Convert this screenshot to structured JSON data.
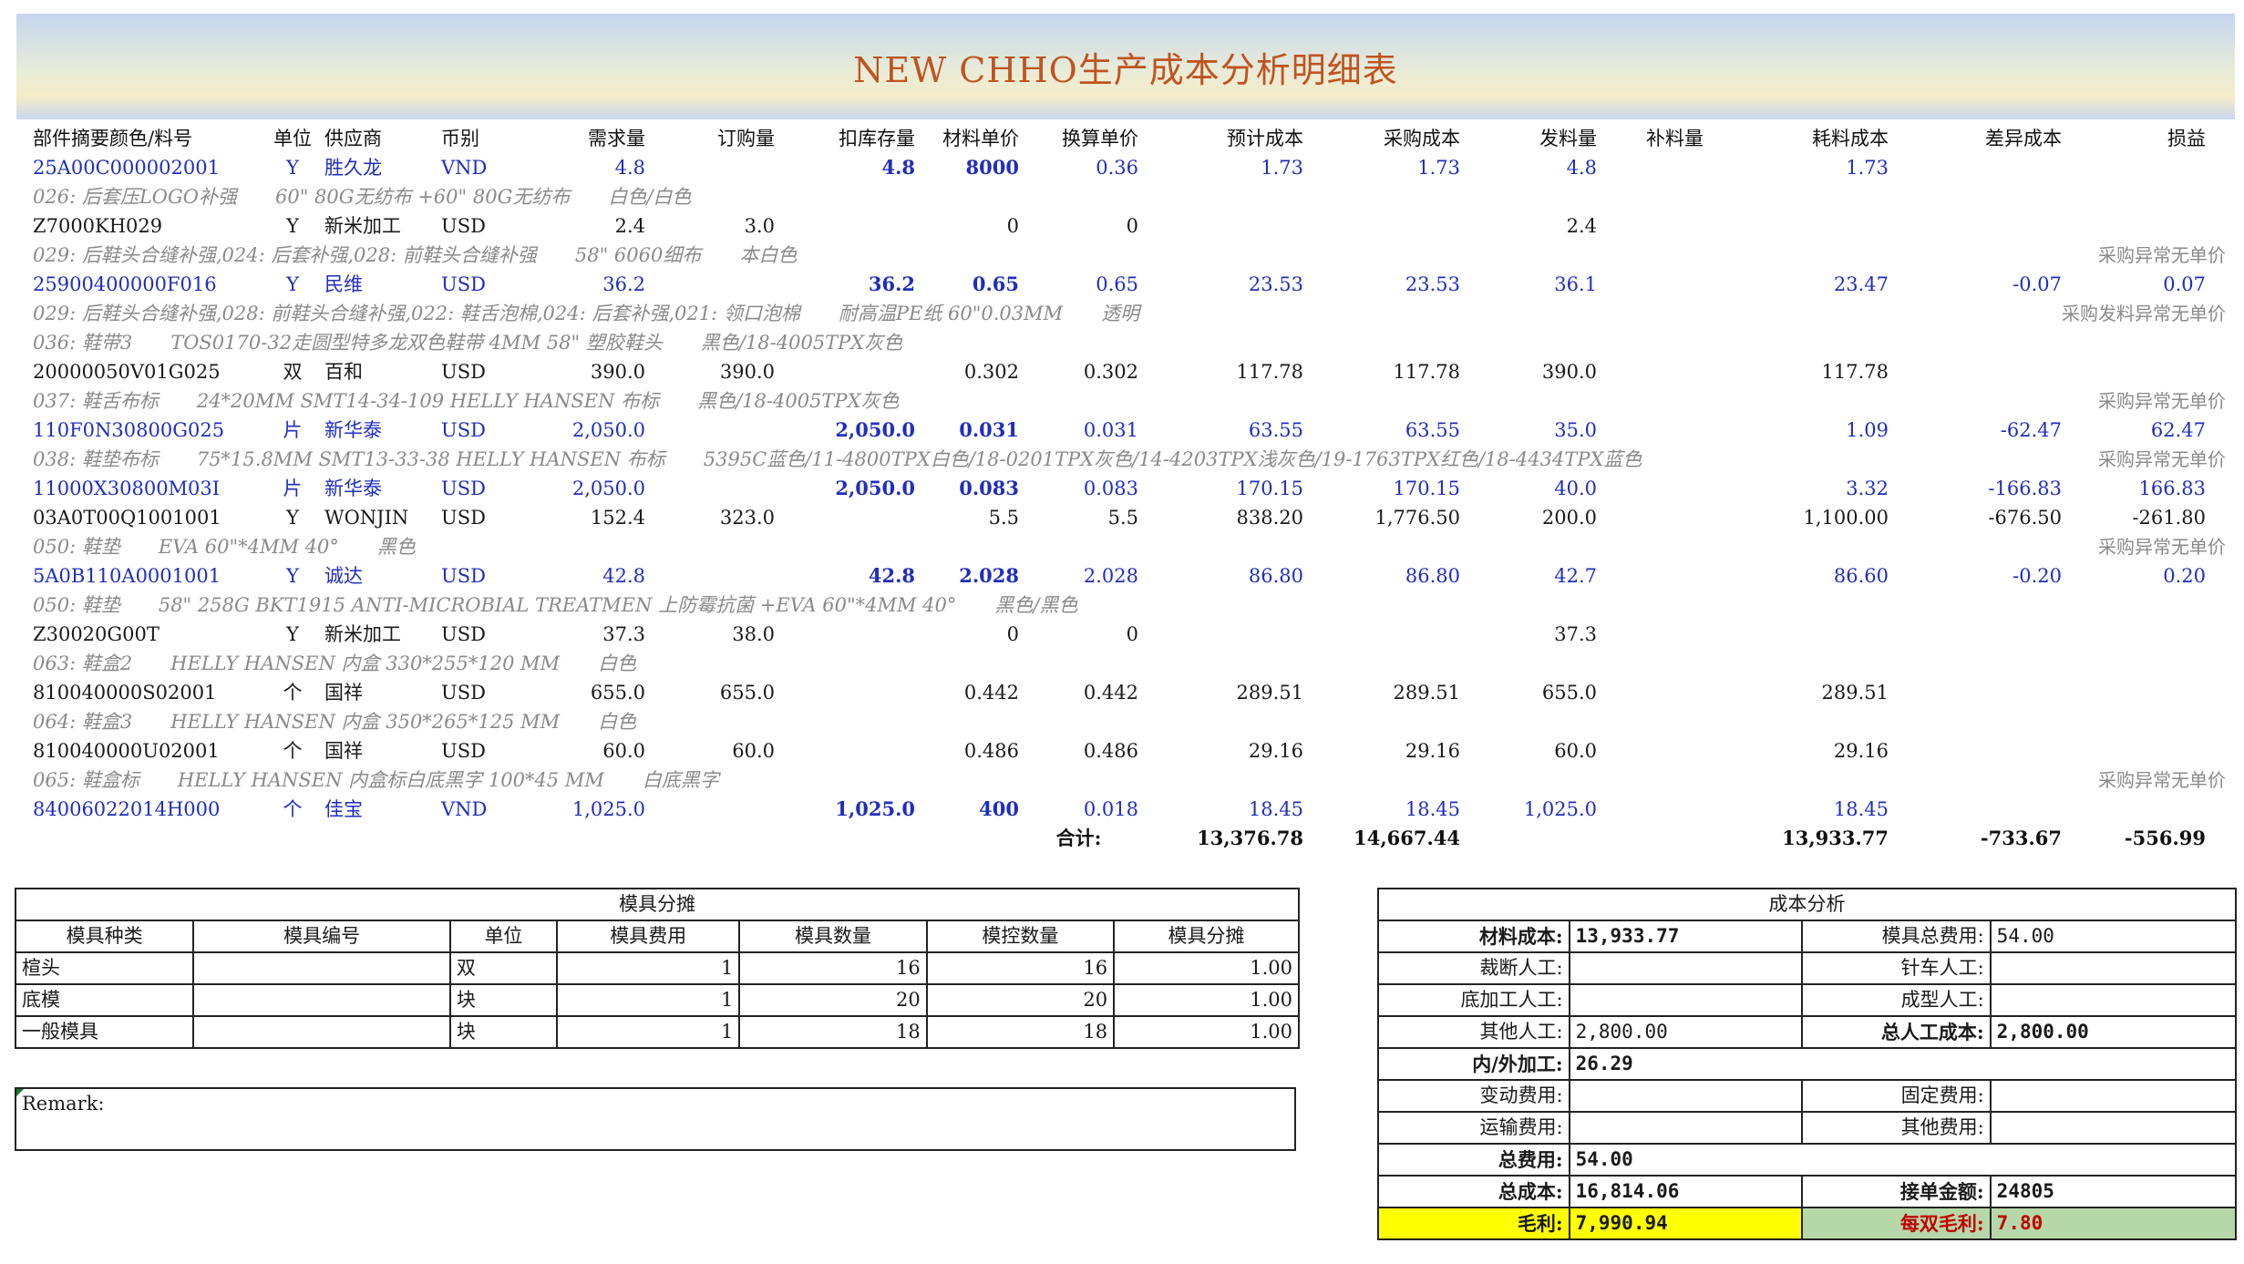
{
  "title": "NEW CHHO生产成本分析明细表",
  "headers": {
    "part": "部件摘要颜色/料号",
    "unit": "单位",
    "supplier": "供应商",
    "currency": "币别",
    "demand": "需求量",
    "order": "订购量",
    "stock": "扣库存量",
    "mat_price": "材料单价",
    "conv_price": "换算单价",
    "est_cost": "预计成本",
    "pur_cost": "采购成本",
    "issue": "发料量",
    "supp": "补料量",
    "consume_cost": "耗料成本",
    "diff_cost": "差异成本",
    "profit_loss": "损益"
  },
  "rows": [
    {
      "type": "data",
      "color": "blue",
      "part": "25A00C000002001",
      "unit": "Y",
      "supplier": "胜久龙",
      "currency": "VND",
      "demand": "4.8",
      "order": "",
      "stock": "4.8",
      "mat_price": "8000",
      "conv_price": "0.36",
      "est_cost": "1.73",
      "pur_cost": "1.73",
      "issue": "4.8",
      "supp": "",
      "consume_cost": "1.73",
      "diff_cost": "",
      "profit_loss": ""
    },
    {
      "type": "desc",
      "text": "026: 后套压LOGO补强　　60\" 80G无纺布 +60\" 80G无纺布　　白色/白色",
      "note": ""
    },
    {
      "type": "data",
      "color": "black",
      "part": "Z7000KH029",
      "unit": "Y",
      "supplier": "新米加工",
      "currency": "USD",
      "demand": "2.4",
      "order": "3.0",
      "stock": "",
      "mat_price": "0",
      "conv_price": "0",
      "est_cost": "",
      "pur_cost": "",
      "issue": "2.4",
      "supp": "",
      "consume_cost": "",
      "diff_cost": "",
      "profit_loss": ""
    },
    {
      "type": "desc",
      "text": "029: 后鞋头合缝补强,024: 后套补强,028: 前鞋头合缝补强　　58\" 6060细布　　本白色",
      "note": "采购异常无单价"
    },
    {
      "type": "data",
      "color": "blue",
      "part": "25900400000F016",
      "unit": "Y",
      "supplier": "民维",
      "currency": "USD",
      "demand": "36.2",
      "order": "",
      "stock": "36.2",
      "mat_price": "0.65",
      "conv_price": "0.65",
      "est_cost": "23.53",
      "pur_cost": "23.53",
      "issue": "36.1",
      "supp": "",
      "consume_cost": "23.47",
      "diff_cost": "-0.07",
      "profit_loss": "0.07"
    },
    {
      "type": "desc",
      "text": "029: 后鞋头合缝补强,028: 前鞋头合缝补强,022: 鞋舌泡棉,024: 后套补强,021: 领口泡棉　　耐高温PE纸 60\"0.03MM　　透明",
      "note": "采购发料异常无单价"
    },
    {
      "type": "desc",
      "text": "036: 鞋带3　　TOS0170-32走圆型特多龙双色鞋带 4MM 58\" 塑胶鞋头　　黑色/18-4005TPX灰色",
      "note": ""
    },
    {
      "type": "data",
      "color": "black",
      "part": "20000050V01G025",
      "unit": "双",
      "supplier": "百和",
      "currency": "USD",
      "demand": "390.0",
      "order": "390.0",
      "stock": "",
      "mat_price": "0.302",
      "conv_price": "0.302",
      "est_cost": "117.78",
      "pur_cost": "117.78",
      "issue": "390.0",
      "supp": "",
      "consume_cost": "117.78",
      "diff_cost": "",
      "profit_loss": ""
    },
    {
      "type": "desc",
      "text": "037: 鞋舌布标　　24*20MM SMT14-34-109 HELLY HANSEN 布标　　黑色/18-4005TPX灰色",
      "note": "采购异常无单价"
    },
    {
      "type": "data",
      "color": "blue",
      "part": "110F0N30800G025",
      "unit": "片",
      "supplier": "新华泰",
      "currency": "USD",
      "demand": "2,050.0",
      "order": "",
      "stock": "2,050.0",
      "mat_price": "0.031",
      "conv_price": "0.031",
      "est_cost": "63.55",
      "pur_cost": "63.55",
      "issue": "35.0",
      "supp": "",
      "consume_cost": "1.09",
      "diff_cost": "-62.47",
      "profit_loss": "62.47"
    },
    {
      "type": "desc",
      "text": "038: 鞋垫布标　　75*15.8MM SMT13-33-38 HELLY HANSEN 布标　　5395C蓝色/11-4800TPX白色/18-0201TPX灰色/14-4203TPX浅灰色/19-1763TPX红色/18-4434TPX蓝色",
      "note": "采购异常无单价"
    },
    {
      "type": "data",
      "color": "blue",
      "part": "11000X30800M03I",
      "unit": "片",
      "supplier": "新华泰",
      "currency": "USD",
      "demand": "2,050.0",
      "order": "",
      "stock": "2,050.0",
      "mat_price": "0.083",
      "conv_price": "0.083",
      "est_cost": "170.15",
      "pur_cost": "170.15",
      "issue": "40.0",
      "supp": "",
      "consume_cost": "3.32",
      "diff_cost": "-166.83",
      "profit_loss": "166.83"
    },
    {
      "type": "data",
      "color": "black",
      "part": "03A0T00Q1001001",
      "unit": "Y",
      "supplier": "WONJIN",
      "currency": "USD",
      "demand": "152.4",
      "order": "323.0",
      "stock": "",
      "mat_price": "5.5",
      "conv_price": "5.5",
      "est_cost": "838.20",
      "pur_cost": "1,776.50",
      "issue": "200.0",
      "supp": "",
      "consume_cost": "1,100.00",
      "diff_cost": "-676.50",
      "profit_loss": "-261.80"
    },
    {
      "type": "desc",
      "text": "050: 鞋垫　　EVA 60\"*4MM 40°　　黑色",
      "note": "采购异常无单价"
    },
    {
      "type": "data",
      "color": "blue",
      "part": "5A0B110A0001001",
      "unit": "Y",
      "supplier": "诚达",
      "currency": "USD",
      "demand": "42.8",
      "order": "",
      "stock": "42.8",
      "mat_price": "2.028",
      "conv_price": "2.028",
      "est_cost": "86.80",
      "pur_cost": "86.80",
      "issue": "42.7",
      "supp": "",
      "consume_cost": "86.60",
      "diff_cost": "-0.20",
      "profit_loss": "0.20"
    },
    {
      "type": "desc",
      "text": "050: 鞋垫　　58\" 258G BKT1915 ANTI-MICROBIAL TREATMEN 上防霉抗菌 +EVA 60\"*4MM 40°　　黑色/黑色",
      "note": ""
    },
    {
      "type": "data",
      "color": "black",
      "part": "Z30020G00T",
      "unit": "Y",
      "supplier": "新米加工",
      "currency": "USD",
      "demand": "37.3",
      "order": "38.0",
      "stock": "",
      "mat_price": "0",
      "conv_price": "0",
      "est_cost": "",
      "pur_cost": "",
      "issue": "37.3",
      "supp": "",
      "consume_cost": "",
      "diff_cost": "",
      "profit_loss": ""
    },
    {
      "type": "desc",
      "text": "063: 鞋盒2　　HELLY HANSEN 内盒 330*255*120 MM　　白色",
      "note": ""
    },
    {
      "type": "data",
      "color": "black",
      "part": "810040000S02001",
      "unit": "个",
      "supplier": "国祥",
      "currency": "USD",
      "demand": "655.0",
      "order": "655.0",
      "stock": "",
      "mat_price": "0.442",
      "conv_price": "0.442",
      "est_cost": "289.51",
      "pur_cost": "289.51",
      "issue": "655.0",
      "supp": "",
      "consume_cost": "289.51",
      "diff_cost": "",
      "profit_loss": ""
    },
    {
      "type": "desc",
      "text": "064: 鞋盒3　　HELLY HANSEN 内盒 350*265*125 MM　　白色",
      "note": ""
    },
    {
      "type": "data",
      "color": "black",
      "part": "810040000U02001",
      "unit": "个",
      "supplier": "国祥",
      "currency": "USD",
      "demand": "60.0",
      "order": "60.0",
      "stock": "",
      "mat_price": "0.486",
      "conv_price": "0.486",
      "est_cost": "29.16",
      "pur_cost": "29.16",
      "issue": "60.0",
      "supp": "",
      "consume_cost": "29.16",
      "diff_cost": "",
      "profit_loss": ""
    },
    {
      "type": "desc",
      "text": "065: 鞋盒标　　HELLY HANSEN 内盒标白底黑字 100*45 MM　　白底黑字",
      "note": "采购异常无单价"
    },
    {
      "type": "data",
      "color": "blue",
      "part": "84006022014H000",
      "unit": "个",
      "supplier": "佳宝",
      "currency": "VND",
      "demand": "1,025.0",
      "order": "",
      "stock": "1,025.0",
      "mat_price": "400",
      "conv_price": "0.018",
      "est_cost": "18.45",
      "pur_cost": "18.45",
      "issue": "1,025.0",
      "supp": "",
      "consume_cost": "18.45",
      "diff_cost": "",
      "profit_loss": ""
    }
  ],
  "totals": {
    "label": "合计:",
    "est_cost": "13,376.78",
    "pur_cost": "14,667.44",
    "consume_cost": "13,933.77",
    "diff_cost": "-733.67",
    "profit_loss": "-556.99"
  },
  "mold": {
    "caption": "模具分摊",
    "headers": [
      "模具种类",
      "模具编号",
      "单位",
      "模具费用",
      "模具数量",
      "模控数量",
      "模具分摊"
    ],
    "rows": [
      [
        "楦头",
        "",
        "双",
        "1",
        "16",
        "16",
        "1.00"
      ],
      [
        "底模",
        "",
        "块",
        "1",
        "20",
        "20",
        "1.00"
      ],
      [
        "一般模具",
        "",
        "块",
        "1",
        "18",
        "18",
        "1.00"
      ]
    ]
  },
  "remark": "Remark:",
  "cost": {
    "caption": "成本分析",
    "material_cost_label": "材料成本:",
    "material_cost": "13,933.77",
    "mold_total_label": "模具总费用:",
    "mold_total": "54.00",
    "cutting_label": "裁断人工:",
    "cutting": "",
    "sewing_label": "针车人工:",
    "sewing": "",
    "sole_label": "底加工人工:",
    "sole": "",
    "forming_label": "成型人工:",
    "forming": "",
    "other_labor_label": "其他人工:",
    "other_labor": "2,800.00",
    "total_labor_label": "总人工成本:",
    "total_labor": "2,800.00",
    "processing_label": "内/外加工:",
    "processing": "26.29",
    "variable_label": "变动费用:",
    "variable": "",
    "fixed_label": "固定费用:",
    "fixed": "",
    "transport_label": "运输费用:",
    "transport": "",
    "other_fee_label": "其他费用:",
    "other_fee": "",
    "total_fee_label": "总费用:",
    "total_fee": "54.00",
    "total_cost_label": "总成本:",
    "total_cost": "16,814.06",
    "order_amount_label": "接单金额:",
    "order_amount": "24805",
    "gross_profit_label": "毛利:",
    "gross_profit": "7,990.94",
    "per_pair_label": "每双毛利:",
    "per_pair": "7.80"
  }
}
